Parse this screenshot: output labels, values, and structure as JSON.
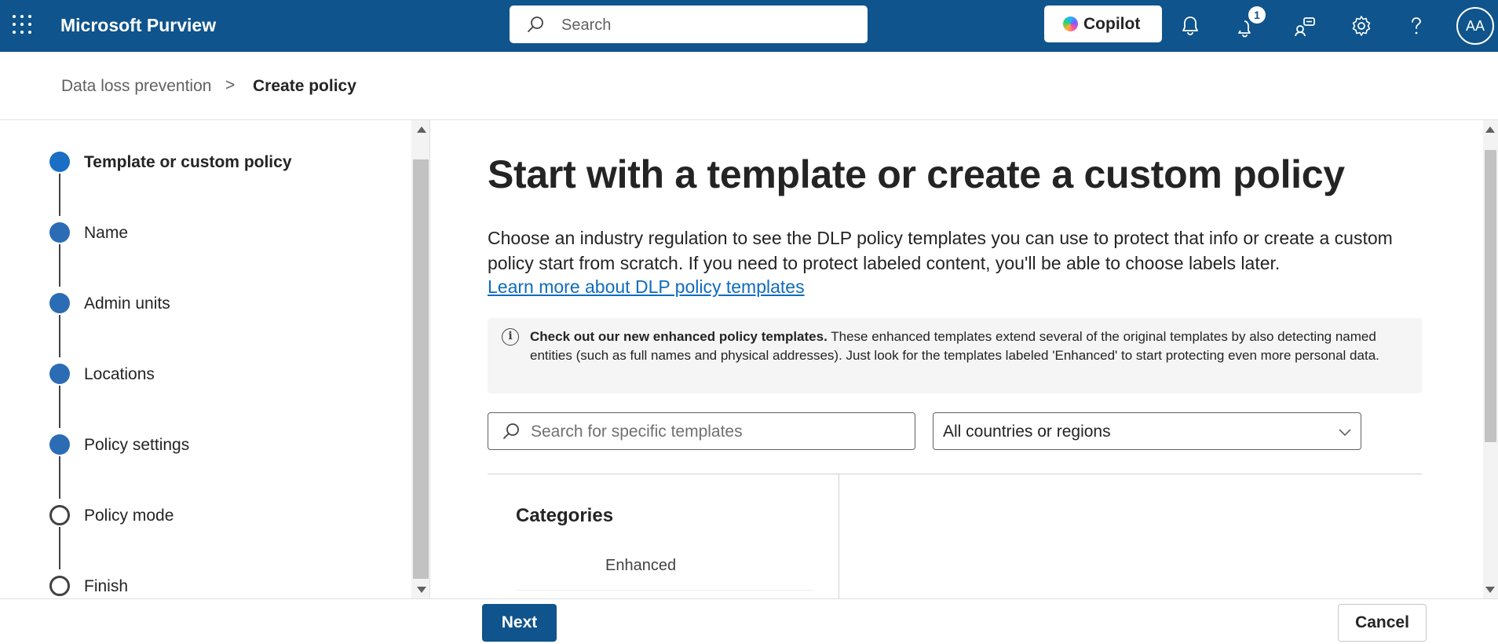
{
  "header": {
    "app_title": "Microsoft Purview",
    "search_placeholder": "Search",
    "copilot_label": "Copilot",
    "notification_count": "1",
    "avatar_initials": "AA"
  },
  "breadcrumb": {
    "items": [
      "Data loss prevention",
      "Create policy"
    ],
    "separator": ">"
  },
  "steps": [
    {
      "label": "Template or custom policy",
      "state": "current"
    },
    {
      "label": "Name",
      "state": "completed"
    },
    {
      "label": "Admin units",
      "state": "completed"
    },
    {
      "label": "Locations",
      "state": "completed"
    },
    {
      "label": "Policy settings",
      "state": "completed"
    },
    {
      "label": "Policy mode",
      "state": "pending"
    },
    {
      "label": "Finish",
      "state": "pending"
    }
  ],
  "main": {
    "title": "Start with a template or create a custom policy",
    "description": "Choose an industry regulation to see the DLP policy templates you can use to protect that info or create a custom policy start from scratch. If you need to protect labeled content, you'll be able to choose labels later.",
    "learn_more": "Learn more about DLP policy templates",
    "info_bold": "Check out our new enhanced policy templates.",
    "info_text": " These enhanced templates extend several of the original templates by also detecting named entities (such as full names and physical addresses). Just look for the templates labeled 'Enhanced' to start protecting even more personal data.",
    "template_search_placeholder": "Search for specific templates",
    "region_selected": "All countries or regions",
    "categories_heading": "Categories",
    "categories": [
      "Enhanced"
    ]
  },
  "footer": {
    "next_label": "Next",
    "cancel_label": "Cancel"
  },
  "colors": {
    "header_bg": "#0f548c",
    "accent": "#0f6cbd",
    "step_filled": "#2b6cb5"
  }
}
